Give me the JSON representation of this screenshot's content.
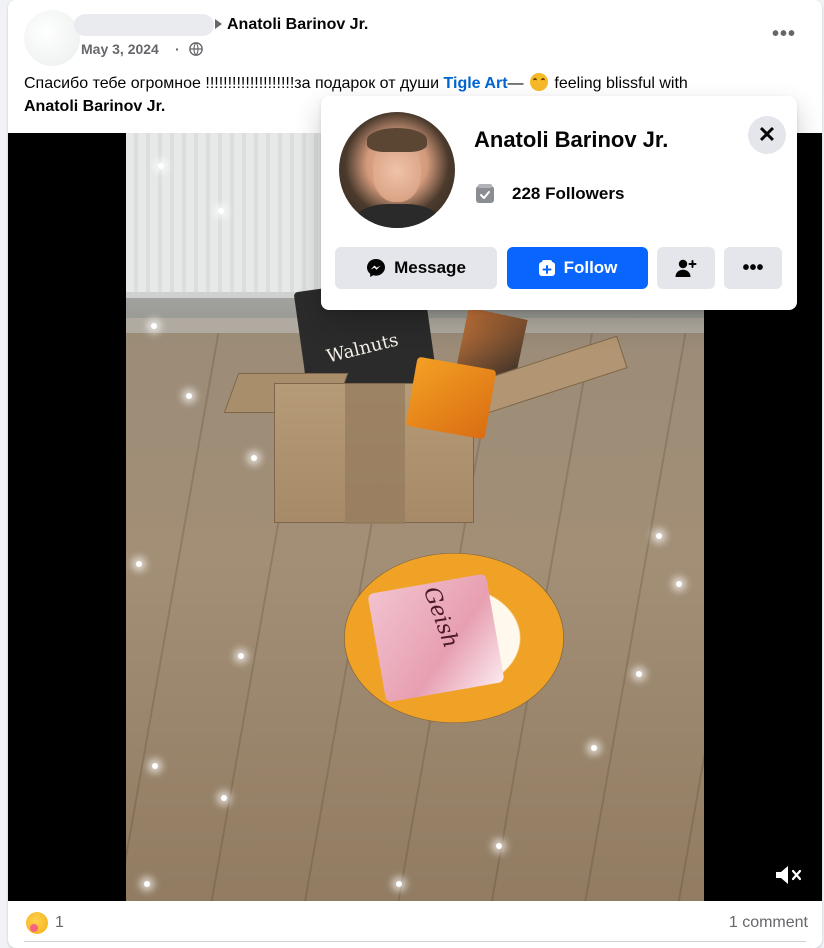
{
  "post": {
    "tagged_name": "Anatoli Barinov Jr.",
    "date": "May 3, 2024",
    "date_separator": "·",
    "text_intro": "Спасибо тебе огромное !!!!!!!!!!!!!!!!!!!!за подарок от души ",
    "text_link": "Tigle Art",
    "text_dash": "— ",
    "text_feeling": " feeling blissful with",
    "text_with_name": "Anatoli Barinov Jr.",
    "more_label": "•••"
  },
  "media": {
    "bag_label": "Walnuts",
    "candy_label": "Geish"
  },
  "reactions": {
    "count": "1",
    "comments": "1 comment"
  },
  "hover_card": {
    "name": "Anatoli Barinov Jr.",
    "followers": "228 Followers",
    "close_label": "✕",
    "message_label": "Message",
    "follow_label": "Follow",
    "more_label": "•••"
  },
  "colors": {
    "accent_blue": "#0866ff",
    "link_blue": "#0064d1",
    "secondary_text": "#65676b",
    "button_gray": "#e4e6eb"
  }
}
